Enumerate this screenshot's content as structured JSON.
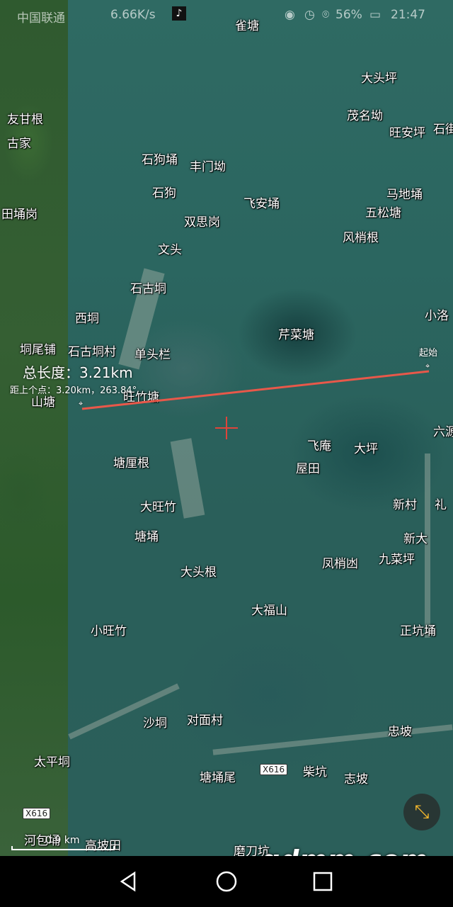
{
  "status_bar": {
    "carrier": "中国联通",
    "speed": "6.66K/s",
    "battery": "56%",
    "time": "21:47"
  },
  "map_labels": [
    {
      "id": "queTang",
      "text": "雀塘"
    },
    {
      "id": "datouping",
      "text": "大头坪"
    },
    {
      "id": "maomingao",
      "text": "茂名坳"
    },
    {
      "id": "wanganping",
      "text": "旺安坪"
    },
    {
      "id": "shijie",
      "text": "石街"
    },
    {
      "id": "yougan",
      "text": "友甘根"
    },
    {
      "id": "gujia",
      "text": "古家"
    },
    {
      "id": "shigouyong",
      "text": "石狗埇"
    },
    {
      "id": "fengmenao",
      "text": "丰门坳"
    },
    {
      "id": "shigou",
      "text": "石狗"
    },
    {
      "id": "feianyong",
      "text": "飞安埇"
    },
    {
      "id": "madiyong",
      "text": "马地埇"
    },
    {
      "id": "tianyonggang",
      "text": "田埇岗"
    },
    {
      "id": "wusongtang",
      "text": "五松塘"
    },
    {
      "id": "shuangsigang",
      "text": "双思岗"
    },
    {
      "id": "fengshaogen",
      "text": "风梢根"
    },
    {
      "id": "wentou",
      "text": "文头"
    },
    {
      "id": "shigujiong",
      "text": "石古垌"
    },
    {
      "id": "xiaoluo",
      "text": "小洛"
    },
    {
      "id": "xijiong",
      "text": "西垌"
    },
    {
      "id": "qincaitang",
      "text": "芹菜塘"
    },
    {
      "id": "jiongweipu",
      "text": "垌尾铺"
    },
    {
      "id": "shigujiongcun",
      "text": "石古垌村"
    },
    {
      "id": "dantoulan",
      "text": "单头栏"
    },
    {
      "id": "shantang",
      "text": "山塘"
    },
    {
      "id": "wangzhutang",
      "text": "旺竹塘"
    },
    {
      "id": "liuyuan",
      "text": "六源"
    },
    {
      "id": "feian",
      "text": "飞庵"
    },
    {
      "id": "daping",
      "text": "大坪"
    },
    {
      "id": "tanglagen",
      "text": "塘厘根"
    },
    {
      "id": "wutian",
      "text": "屋田"
    },
    {
      "id": "dawangzhu",
      "text": "大旺竹"
    },
    {
      "id": "xincun",
      "text": "新村"
    },
    {
      "id": "li",
      "text": "礼"
    },
    {
      "id": "tangyong",
      "text": "塘埇"
    },
    {
      "id": "xinda",
      "text": "新大"
    },
    {
      "id": "fengshaoqiu",
      "text": "凤梢凼"
    },
    {
      "id": "jiucaiping",
      "text": "九菜坪"
    },
    {
      "id": "datougen",
      "text": "大头根"
    },
    {
      "id": "dafushan",
      "text": "大福山"
    },
    {
      "id": "xiaowangzhu",
      "text": "小旺竹"
    },
    {
      "id": "zhengkengyong",
      "text": "正坑埇"
    },
    {
      "id": "shajiong",
      "text": "沙垌"
    },
    {
      "id": "duimiancun",
      "text": "对面村"
    },
    {
      "id": "zhongpo",
      "text": "忠坡"
    },
    {
      "id": "taipingjiong",
      "text": "太平垌"
    },
    {
      "id": "tangyongwei",
      "text": "塘埇尾"
    },
    {
      "id": "chaikeng",
      "text": "柴坑"
    },
    {
      "id": "zhipo",
      "text": "志坡"
    },
    {
      "id": "hebaoyong",
      "text": "河包埇"
    },
    {
      "id": "gaopotian",
      "text": "高坡田"
    },
    {
      "id": "modaokeng",
      "text": "磨刀坑"
    }
  ],
  "measure": {
    "total_length": "总长度：3.21km",
    "prev_point": "距上个点：3.20km，263.84°",
    "start_label": "起始",
    "line_color": "#e8584a"
  },
  "road_badges": [
    "X616",
    "X616"
  ],
  "scale": {
    "text": "0.9 km"
  },
  "watermark": "gdmm.com",
  "nav": {
    "back": "back-icon",
    "home": "home-icon",
    "recent": "recent-apps-icon"
  }
}
